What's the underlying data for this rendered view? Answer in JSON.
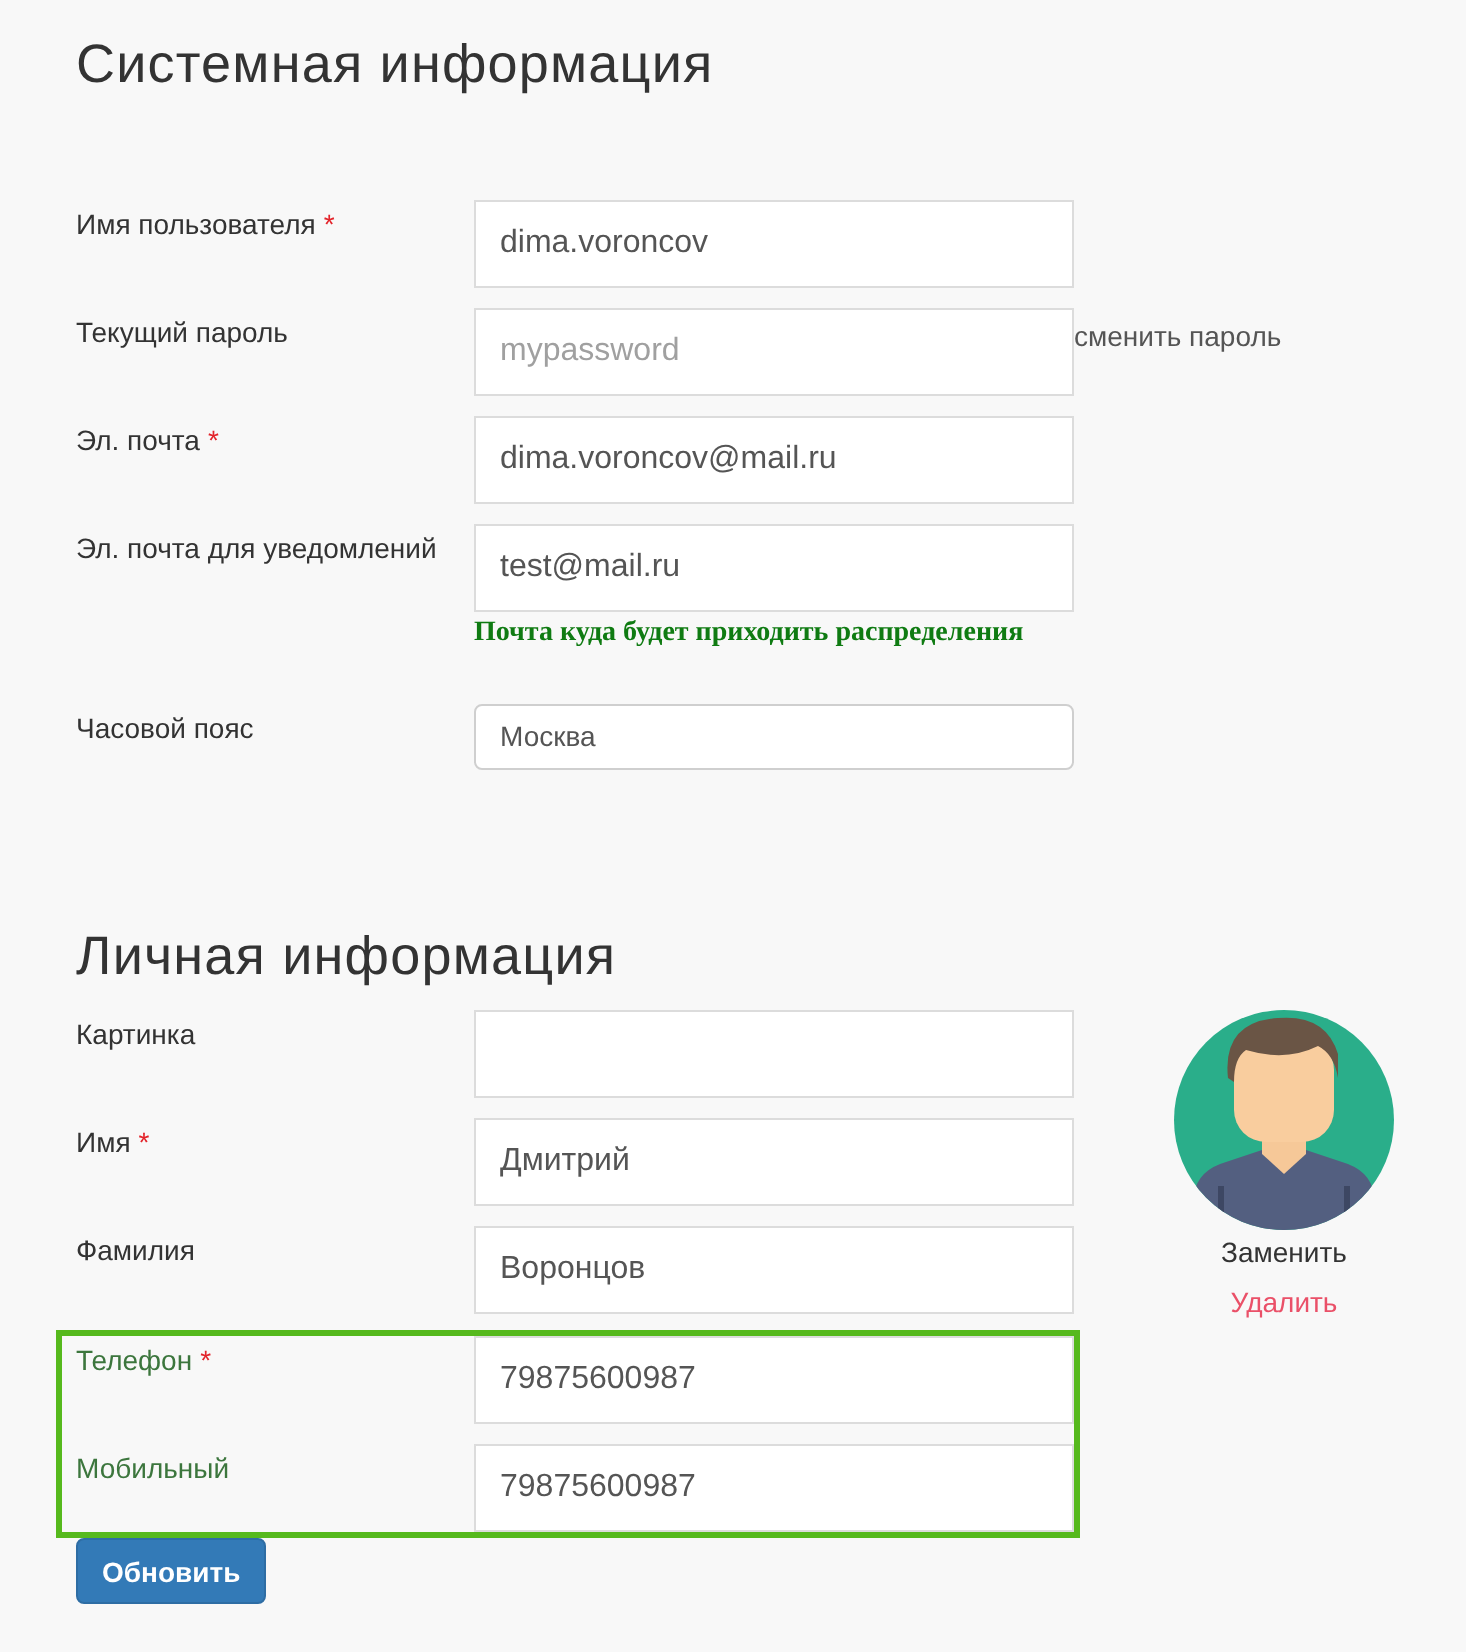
{
  "system_info": {
    "title": "Системная информация",
    "fields": [
      {
        "kind": "text",
        "label": "Имя пользователя",
        "required_mark": "*",
        "value": "dima.voroncov"
      },
      {
        "kind": "password",
        "label": "Текущий пароль",
        "placeholder": "mypassword",
        "link": "сменить пароль"
      },
      {
        "kind": "text",
        "label": "Эл. почта",
        "required_mark": "*",
        "value": "dima.voroncov@mail.ru"
      },
      {
        "kind": "text",
        "label": "Эл. почта для уведомлений",
        "value": "test@mail.ru",
        "hint": "Почта куда будет приходить распределения"
      },
      {
        "kind": "select",
        "label": "Часовой пояс",
        "value": "Москва"
      }
    ]
  },
  "personal_info": {
    "title": "Личная информация",
    "fields": [
      {
        "kind": "text",
        "label": "Картинка",
        "highlighted": false
      },
      {
        "kind": "text",
        "label": "Имя",
        "required_mark": "*",
        "value": "Дмитрий",
        "highlighted": false
      },
      {
        "kind": "text",
        "label": "Фамилия",
        "value": "Воронцов",
        "highlighted": false
      },
      {
        "kind": "text",
        "label": "Телефон",
        "required_mark": "*",
        "value": "79875600987",
        "highlighted": true
      },
      {
        "kind": "text",
        "label": "Мобильный",
        "value": "79875600987",
        "highlighted": true
      }
    ],
    "avatar": {
      "replace_link": "Заменить",
      "delete_link": "Удалить"
    }
  },
  "update_button": "Обновить"
}
